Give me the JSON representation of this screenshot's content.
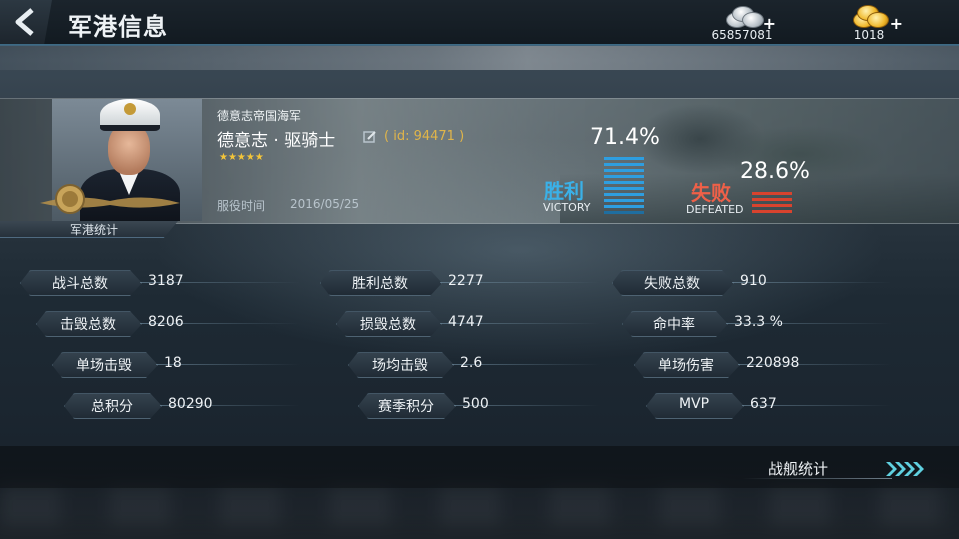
{
  "header": {
    "title": "军港信息",
    "currencies": [
      {
        "kind": "silver-coins-icon",
        "amount": "65857081",
        "plus": "+"
      },
      {
        "kind": "gold-coins-icon",
        "amount": "1018",
        "plus": "+"
      }
    ]
  },
  "profile": {
    "country": "德意志帝国海军",
    "name": "德意志 · 驱骑士",
    "id_text": "( id: 94471 )",
    "stars": "★★★★★",
    "service_label": "服役时间",
    "service_date": "2016/05/25",
    "victory": {
      "pct_text": "71.4%",
      "pct": 71.4,
      "label": "胜利",
      "sub": "VICTORY",
      "color": "#2e9ee0"
    },
    "defeat": {
      "pct_text": "28.6%",
      "pct": 28.6,
      "label": "失败",
      "sub": "DEFEATED",
      "color": "#d8432e"
    }
  },
  "harbor_tab": "军港统计",
  "stats": [
    [
      {
        "label": "战斗总数",
        "value": "3187"
      },
      {
        "label": "击毁总数",
        "value": "8206"
      },
      {
        "label": "单场击毁",
        "value": "18"
      },
      {
        "label": "总积分",
        "value": "80290"
      }
    ],
    [
      {
        "label": "胜利总数",
        "value": "2277"
      },
      {
        "label": "损毁总数",
        "value": "4747"
      },
      {
        "label": "场均击毁",
        "value": "2.6"
      },
      {
        "label": "赛季积分",
        "value": "500"
      }
    ],
    [
      {
        "label": "失败总数",
        "value": "910"
      },
      {
        "label": "命中率",
        "value": "33.3 %"
      },
      {
        "label": "单场伤害",
        "value": "220898"
      },
      {
        "label": "MVP",
        "value": "637"
      }
    ]
  ],
  "footer": {
    "ship_stats_label": "战舰统计"
  }
}
